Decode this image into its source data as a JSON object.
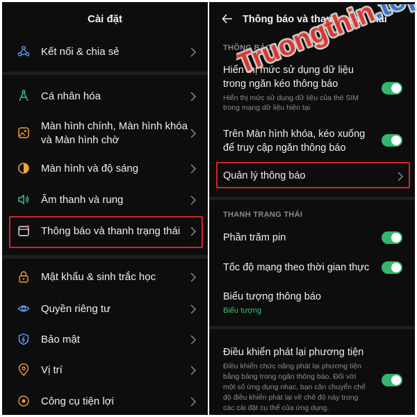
{
  "left": {
    "title": "Cài đặt",
    "items": [
      {
        "label": "Kết nối & chia sẻ",
        "icon": "share-icon"
      },
      {
        "label": "Cá nhân hóa",
        "icon": "compass-icon"
      },
      {
        "label_line1": "Màn hình chính, Màn hình khóa",
        "label_line2": "và Màn hình chờ",
        "icon": "picture-icon"
      },
      {
        "label": "Màn hình và độ sáng",
        "icon": "brightness-icon"
      },
      {
        "label": "Âm thanh và rung",
        "icon": "speaker-icon"
      },
      {
        "label": "Thông báo và thanh trạng thái",
        "icon": "notification-icon"
      },
      {
        "label": "Mật khẩu & sinh trắc học",
        "icon": "lock-icon"
      },
      {
        "label": "Quyền riêng tư",
        "icon": "eye-icon"
      },
      {
        "label": "Bảo mật",
        "icon": "shield-icon"
      },
      {
        "label": "Vị trí",
        "icon": "location-icon"
      },
      {
        "label": "Công cụ tiện lợi",
        "icon": "tools-icon"
      }
    ]
  },
  "right": {
    "title": "Thông báo và thanh trạng thái",
    "section_notifications": "THÔNG BÁO",
    "data_usage": {
      "line1": "Hiển thị mức sử dụng dữ liệu",
      "line2": "trong ngăn kéo thông báo",
      "sub1": "Hiển thị mức sử dụng dữ liệu của thẻ SIM",
      "sub2": "trong mạng dữ liệu hiện tại"
    },
    "lockscreen": {
      "line1": "Trên Màn hình khóa, kéo xuống",
      "line2": "để truy cập ngăn thông báo"
    },
    "manage": "Quản lý thông báo",
    "section_status": "THANH TRẠNG THÁI",
    "battery_percent": "Phần trăm pin",
    "network_speed": "Tốc độ mạng theo thời gian thực",
    "notification_icons": {
      "title": "Biểu tượng thông báo",
      "value": "Biểu tượng"
    },
    "media_playback": {
      "title": "Điều khiển phát lại phương tiện",
      "sub1": "Điều khiển chức năng phát lại phương tiện",
      "sub2": "bằng bảng trong ngăn thông báo. Đối với",
      "sub3": "một số ứng dụng nhạc, bạn cần chuyển chế",
      "sub4": "độ điều khiển phát lại về chế độ này trong",
      "sub5": "các cài đặt cụ thể của ứng dụng."
    },
    "toggles": {
      "data_usage": true,
      "lockscreen": true,
      "battery_percent": true,
      "network_speed": true,
      "media_playback": true
    }
  },
  "colors": {
    "background": "#0d0d0d",
    "highlight": "#d8232a",
    "toggle_on": "#33b86b",
    "green_text": "#38c172"
  },
  "watermark": {
    "text": "Truongthin.top"
  }
}
